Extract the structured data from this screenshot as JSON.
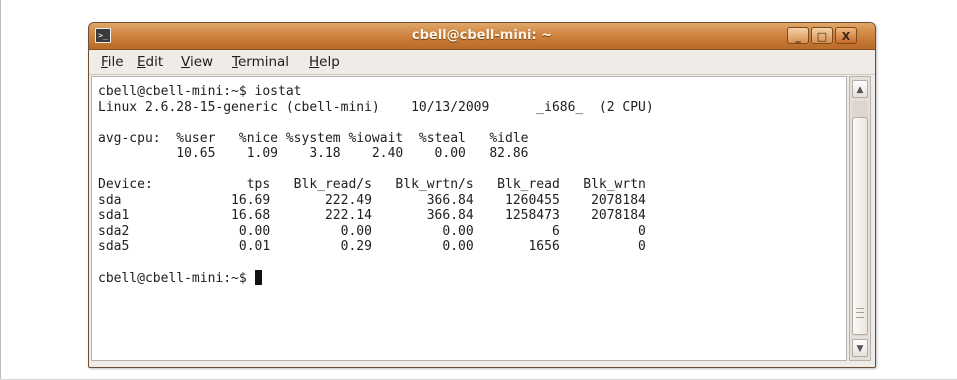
{
  "window": {
    "title": "cbell@cbell-mini: ~",
    "app_icon": "terminal-icon",
    "controls": {
      "minimize": "_",
      "maximize": "□",
      "close": "X"
    }
  },
  "menu": {
    "file": {
      "mnemonic": "F",
      "rest": "ile"
    },
    "edit": {
      "mnemonic": "E",
      "rest": "dit"
    },
    "view": {
      "mnemonic": "V",
      "rest": "iew"
    },
    "terminal": {
      "mnemonic": "T",
      "rest": "erminal"
    },
    "help": {
      "mnemonic": "H",
      "rest": "elp"
    }
  },
  "terminal": {
    "lines": [
      "cbell@cbell-mini:~$ iostat",
      "Linux 2.6.28-15-generic (cbell-mini)    10/13/2009      _i686_  (2 CPU)",
      "",
      "avg-cpu:  %user   %nice %system %iowait  %steal   %idle",
      "          10.65    1.09    3.18    2.40    0.00   82.86",
      "",
      "Device:            tps   Blk_read/s   Blk_wrtn/s   Blk_read   Blk_wrtn",
      "sda              16.69       222.49       366.84    1260455    2078184",
      "sda1             16.68       222.14       366.84    1258473    2078184",
      "sda2              0.00         0.00         0.00          6          0",
      "sda5              0.01         0.29         0.00       1656          0",
      ""
    ],
    "prompt": "cbell@cbell-mini:~$ "
  },
  "scrollbar": {
    "up_icon": "arrow-up-icon",
    "down_icon": "arrow-down-icon"
  },
  "colors": {
    "titlebar": "#cf8440",
    "menubar": "#efebe7",
    "terminal_bg": "#ffffff",
    "terminal_fg": "#202020"
  }
}
